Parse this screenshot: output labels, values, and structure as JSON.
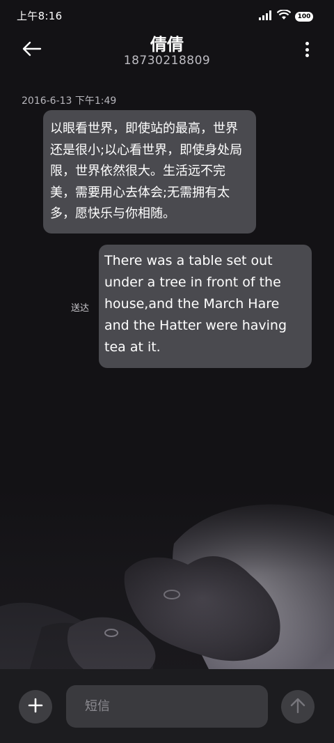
{
  "status_bar": {
    "time": "上午8:16",
    "battery": "100",
    "icons": [
      "signal-icon",
      "wifi-icon",
      "battery-icon"
    ]
  },
  "header": {
    "contact_name": "倩倩",
    "contact_number": "18730218809",
    "back_icon": "back-arrow-icon",
    "more_icon": "more-vertical-icon"
  },
  "conversation": {
    "timestamp": "2016-6-13 下午1:49",
    "received_message": "以眼看世界，即使站的最高，世界还是很小;以心看世界，即使身处局限，世界依然很大。生活远不完美，需要用心去体会;无需拥有太多，愿快乐与你相随。",
    "sent_message": "There was a table set out under a tree in front of the house,and the March Hare and the Hatter were having tea at it.",
    "sent_status": "送达"
  },
  "composer": {
    "placeholder": "短信",
    "value": "",
    "add_icon": "plus-icon",
    "send_icon": "send-arrow-up-icon"
  },
  "colors": {
    "background": "#131215",
    "bubble": "#4a4a4f",
    "composer_bar": "#1c1c1f",
    "input": "#3a3a3e"
  }
}
